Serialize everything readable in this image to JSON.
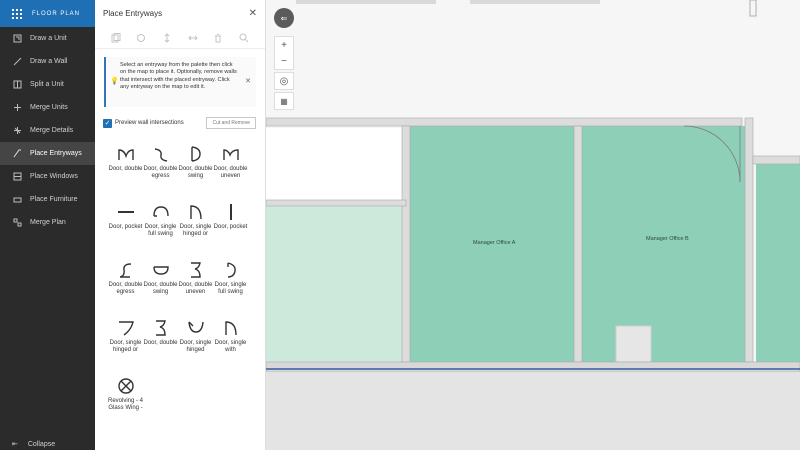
{
  "sidebar": {
    "title": "FLOOR PLAN",
    "items": [
      {
        "label": "Draw a Unit",
        "icon": "draw-unit-icon"
      },
      {
        "label": "Draw a Wall",
        "icon": "draw-wall-icon"
      },
      {
        "label": "Split a Unit",
        "icon": "split-unit-icon"
      },
      {
        "label": "Merge Units",
        "icon": "merge-units-icon"
      },
      {
        "label": "Merge Details",
        "icon": "merge-details-icon"
      },
      {
        "label": "Place Entryways",
        "icon": "entryway-icon"
      },
      {
        "label": "Place Windows",
        "icon": "window-icon"
      },
      {
        "label": "Place Furniture",
        "icon": "furniture-icon"
      },
      {
        "label": "Merge Plan",
        "icon": "merge-plan-icon"
      }
    ],
    "active_index": 5,
    "collapse_label": "Collapse"
  },
  "panel": {
    "title": "Place Entryways",
    "info": "Select an entryway from the palette then click on the map to place it. Optionally, remove walls that intersect with the placed entryway. Click any entryway on the map to edit it.",
    "preview_label": "Preview wall intersections",
    "cut_button": "Cut and Remove",
    "entryways": [
      {
        "label": "Door, double",
        "glyph": "double"
      },
      {
        "label": "Door, double egress",
        "glyph": "egress"
      },
      {
        "label": "Door, double swing",
        "glyph": "dswing"
      },
      {
        "label": "Door, double uneven",
        "glyph": "uneven"
      },
      {
        "label": "Door, pocket",
        "glyph": "pocket"
      },
      {
        "label": "Door, single full swing",
        "glyph": "fullswing"
      },
      {
        "label": "Door, single hinged or",
        "glyph": "hinged"
      },
      {
        "label": "Door, pocket",
        "glyph": "pocket2"
      },
      {
        "label": "Door, double egress",
        "glyph": "egress2"
      },
      {
        "label": "Door, double swing",
        "glyph": "dswing2"
      },
      {
        "label": "Door, double uneven",
        "glyph": "uneven2"
      },
      {
        "label": "Door, single full swing",
        "glyph": "fullswing2"
      },
      {
        "label": "Door, single hinged or",
        "glyph": "hinged2"
      },
      {
        "label": "Door, double",
        "glyph": "double2"
      },
      {
        "label": "Door, single hinged",
        "glyph": "hinged3"
      },
      {
        "label": "Door, single with",
        "glyph": "with"
      },
      {
        "label": "Revolving - 4 Glass Wing -",
        "glyph": "revolving"
      }
    ]
  },
  "map": {
    "rooms": [
      {
        "label": "Manager Office A"
      },
      {
        "label": "Manager Office B"
      }
    ],
    "colors": {
      "room_fill": "#8ecfb8",
      "room_light": "#cde9dc",
      "wall": "#b0b0b0",
      "accent": "#1f6fb5"
    }
  }
}
